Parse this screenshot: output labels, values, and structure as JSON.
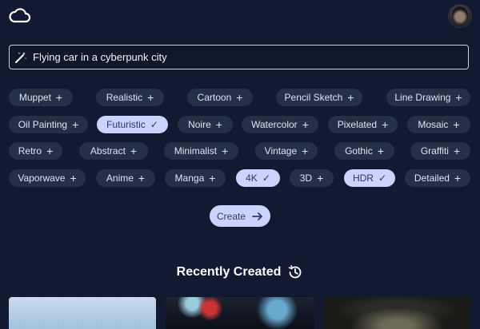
{
  "prompt": {
    "value": "Flying car in a cyberpunk city"
  },
  "styles": [
    {
      "label": "Muppet",
      "selected": false
    },
    {
      "label": "Realistic",
      "selected": false
    },
    {
      "label": "Cartoon",
      "selected": false
    },
    {
      "label": "Pencil Sketch",
      "selected": false
    },
    {
      "label": "Line Drawing",
      "selected": false
    },
    {
      "label": "Oil Painting",
      "selected": false
    },
    {
      "label": "Futuristic",
      "selected": true
    },
    {
      "label": "Noire",
      "selected": false
    },
    {
      "label": "Watercolor",
      "selected": false
    },
    {
      "label": "Pixelated",
      "selected": false
    },
    {
      "label": "Mosaic",
      "selected": false
    },
    {
      "label": "Retro",
      "selected": false
    },
    {
      "label": "Abstract",
      "selected": false
    },
    {
      "label": "Minimalist",
      "selected": false
    },
    {
      "label": "Vintage",
      "selected": false
    },
    {
      "label": "Gothic",
      "selected": false
    },
    {
      "label": "Graffiti",
      "selected": false
    },
    {
      "label": "Vaporwave",
      "selected": false
    },
    {
      "label": "Anime",
      "selected": false
    },
    {
      "label": "Manga",
      "selected": false
    },
    {
      "label": "4K",
      "selected": true
    },
    {
      "label": "3D",
      "selected": false
    },
    {
      "label": "HDR",
      "selected": true
    },
    {
      "label": "Detailed",
      "selected": false
    }
  ],
  "create_label": "Create",
  "recent": {
    "title": "Recently Created"
  },
  "colors": {
    "background": "#111a30",
    "chip": "#243048",
    "chip_selected": "#c9d4ff"
  }
}
